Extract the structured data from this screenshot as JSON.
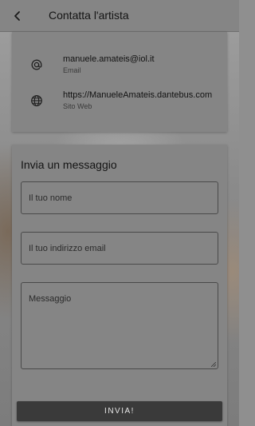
{
  "header": {
    "title": "Contatta l'artista",
    "back_icon": "arrow-left-icon"
  },
  "contacts": [
    {
      "icon": "at-sign-icon",
      "value": "manuele.amateis@iol.it",
      "label": "Email"
    },
    {
      "icon": "globe-icon",
      "value": "https://ManueleAmateis.dantebus.com",
      "label": "Sito Web"
    }
  ],
  "form": {
    "title": "Invia un messaggio",
    "name_placeholder": "Il tuo nome",
    "email_placeholder": "Il tuo indirizzo email",
    "message_placeholder": "Messaggio",
    "submit_label": "INVIA!"
  },
  "colors": {
    "overlay": "#858585",
    "button": "#3a3a3a",
    "text": "#141414"
  }
}
